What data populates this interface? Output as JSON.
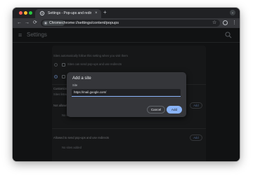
{
  "tab": {
    "title": "Settings - Pop-ups and redir",
    "close": "×",
    "new_tab": "+"
  },
  "toolbar": {
    "back": "←",
    "forward": "→",
    "reload": "⟳",
    "chip_label": "Chrome",
    "url": "chrome://settings/content/popups",
    "bookmark": "☆",
    "menu": "⋮"
  },
  "settings": {
    "menu_glyph": "≡",
    "title": "Settings"
  },
  "content": {
    "intro": "Sites automatically follow this setting when you visit them",
    "option_allow": "Sites can send pop-ups and use redirects",
    "option_block": "Don't allow sites to send pop-ups or use redirects",
    "custom_heading": "Customized behaviors",
    "custom_sub": "Sites listed below follow a custom setting instead of the default",
    "not_allowed_heading": "Not allowed to send pop-ups or use redirects",
    "not_allowed_empty": "No sites added",
    "allowed_heading": "Allowed to send pop-ups and use redirects",
    "allowed_empty": "No sites added",
    "add_label": "Add"
  },
  "dialog": {
    "title": "Add a site",
    "field_label": "Site",
    "field_value": "https://mail.google.com/",
    "cancel": "Cancel",
    "add": "Add"
  },
  "colors": {
    "accent": "#8ab4f8",
    "background": "#202124",
    "dialog": "#35363a"
  }
}
